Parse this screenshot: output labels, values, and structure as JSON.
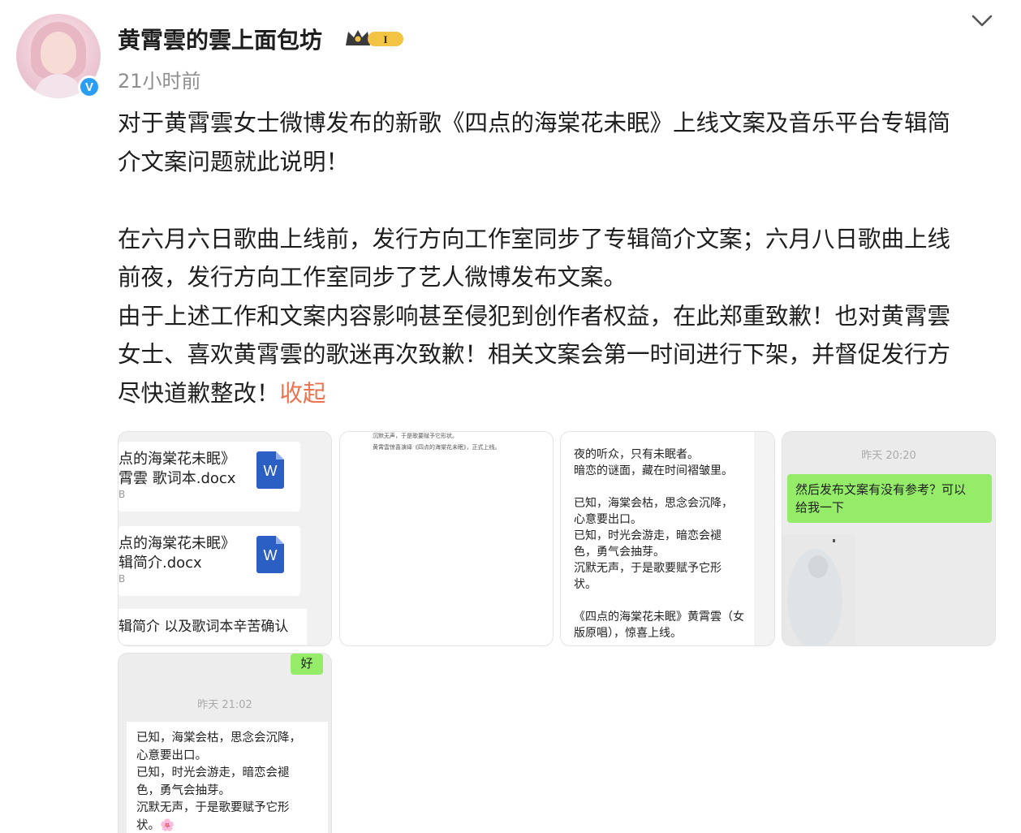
{
  "header": {
    "username": "黄霄雲的雲上面包坊",
    "level_badge": "I",
    "timestamp": "21小时前",
    "verified_mark": "V"
  },
  "post": {
    "lines": [
      "对于黄霄雲女士微博发布的新歌《四点的海棠花未眠》上线文案及音乐平台专辑简",
      "介文案问题就此说明！",
      "",
      "在六月六日歌曲上线前，发行方向工作室同步了专辑简介文案；六月八日歌曲上线",
      "前夜，发行方向工作室同步了艺人微博发布文案。",
      "由于上述工作和文案内容影响甚至侵犯到创作者权益，在此郑重致歉！也对黄霄雲",
      "女士、喜欢黄霄雲的歌迷再次致歉！相关文案会第一时间进行下架，并督促发行方",
      "尽快道歉整改！"
    ],
    "collapse_label": "收起"
  },
  "images": {
    "img1": {
      "file1_line1": "点的海棠花未眠》",
      "file1_line2": "霄雲 歌词本.docx",
      "file1_size": "B",
      "file2_line1": "点的海棠花未眠》",
      "file2_line2": "辑简介.docx",
      "file2_size": "B",
      "word_letter": "W",
      "confirm_text": "辑简介 以及歌词本辛苦确认"
    },
    "img2": {
      "line1": "沉默无声，于是歌要赋予它形状。",
      "line2": "黄霄雲惊喜演绎《四点的海棠花未眠》，正式上线。"
    },
    "img3": {
      "lines": [
        "夜的听众，只有未眠者。",
        "暗恋的谜面，藏在时间褶皱里。",
        "",
        "已知，海棠会枯，思念会沉降，",
        "心意要出口。",
        "已知，时光会游走，暗恋会褪",
        "色，勇气会抽芽。",
        "沉默无声，于是歌要赋予它形",
        "状。",
        "",
        "《四点的海棠花未眠》黄霄雲（女",
        "版原唱），惊喜上线。"
      ]
    },
    "img4": {
      "time": "昨天 20:20",
      "bubble_line1": "然后发布文案有没有参考？可以",
      "bubble_line2": "给我一下"
    },
    "img5": {
      "reply": "好",
      "time": "昨天 21:02",
      "lines": [
        "已知，海棠会枯，思念会沉降，",
        "心意要出口。",
        "已知，时光会游走，暗恋会褪",
        "色，勇气会抽芽。",
        "沉默无声，于是歌要赋予它形",
        "状。"
      ],
      "emoji": "🌸"
    }
  },
  "colors": {
    "accent_link": "#eb7350",
    "verified_blue": "#2a9df4",
    "chat_green": "#95ec69",
    "word_blue": "#2b5fc4",
    "crown_gold": "#f3c343"
  }
}
